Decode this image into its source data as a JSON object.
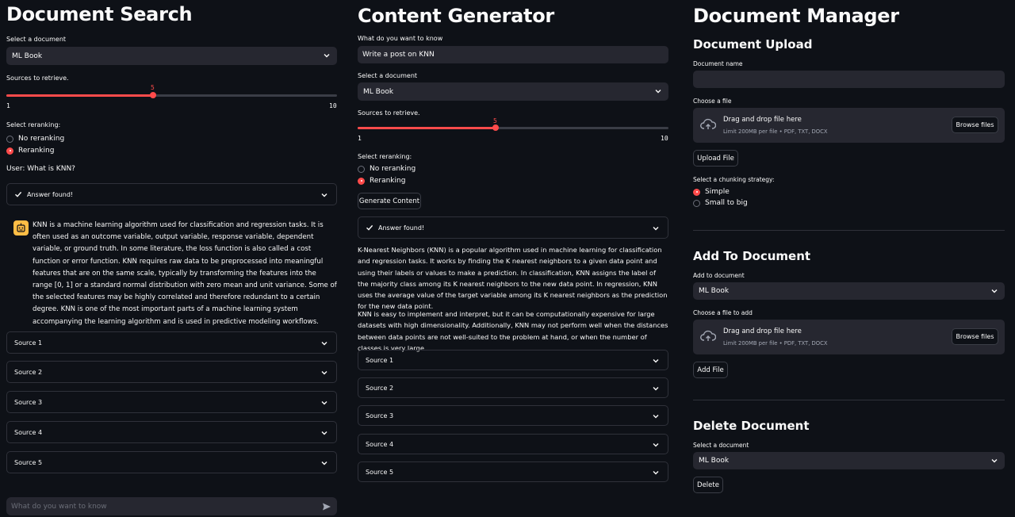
{
  "search": {
    "title": "Document Search",
    "select_doc_label": "Select a document",
    "select_doc_value": "ML Book",
    "sources_label": "Sources to retrieve.",
    "slider": {
      "value": "5",
      "min": "1",
      "max": "10",
      "fraction": 0.444
    },
    "rerank_label": "Select reranking:",
    "rerank_options": [
      "No reranking",
      "Reranking"
    ],
    "user_query": "User: What is KNN?",
    "status": "Answer found!",
    "answer": "KNN is a machine learning algorithm used for classification and regression tasks. It is often used as an outcome variable, output variable, response variable, dependent variable, or ground truth. In some literature, the loss function is also called a cost function or error function. KNN requires raw data to be preprocessed into meaningful features that are on the same scale, typically by transforming the features into the range [0, 1] or a standard normal distribution with zero mean and unit variance. Some of the selected features may be highly correlated and therefore redundant to a certain degree. KNN is one of the most important parts of a machine learning system accompanying the learning algorithm and is used in predictive modeling workflows.",
    "sources": [
      "Source 1",
      "Source 2",
      "Source 3",
      "Source 4",
      "Source 5"
    ],
    "chat_placeholder": "What do you want to know"
  },
  "generator": {
    "title": "Content Generator",
    "prompt_label": "What do you want to know",
    "prompt_value": "Write a post on KNN",
    "select_doc_label": "Select a document",
    "select_doc_value": "ML Book",
    "sources_label": "Sources to retrieve.",
    "slider": {
      "value": "5",
      "min": "1",
      "max": "10",
      "fraction": 0.444
    },
    "rerank_label": "Select reranking:",
    "rerank_options": [
      "No reranking",
      "Reranking"
    ],
    "generate_button": "Generate Content",
    "status": "Answer found!",
    "para1": "K-Nearest Neighbors (KNN) is a popular algorithm used in machine learning for classification and regression tasks. It works by finding the K nearest neighbors to a given data point and using their labels or values to make a prediction. In classification, KNN assigns the label of the majority class among its K nearest neighbors to the new data point. In regression, KNN uses the average value of the target variable among its K nearest neighbors as the prediction for the new data point.",
    "para2": "KNN is easy to implement and interpret, but it can be computationally expensive for large datasets with high dimensionality. Additionally, KNN may not perform well when the distances between data points are not well-suited to the problem at hand, or when the number of classes is very large.",
    "sources": [
      "Source 1",
      "Source 2",
      "Source 3",
      "Source 4",
      "Source 5"
    ]
  },
  "manager": {
    "title": "Document Manager",
    "upload": {
      "heading": "Document Upload",
      "name_label": "Document name",
      "name_value": "",
      "file_label": "Choose a file",
      "drop_text": "Drag and drop file here",
      "limit_text": "Limit 200MB per file • PDF, TXT, DOCX",
      "browse_button": "Browse files",
      "upload_button": "Upload File",
      "chunk_label": "Select a chunking strategy:",
      "chunk_options": [
        "Simple",
        "Small to big"
      ]
    },
    "add": {
      "heading": "Add To Document",
      "doc_label": "Add to document",
      "doc_value": "ML Book",
      "file_label": "Choose a file to add",
      "drop_text": "Drag and drop file here",
      "limit_text": "Limit 200MB per file • PDF, TXT, DOCX",
      "browse_button": "Browse files",
      "add_button": "Add File"
    },
    "delete": {
      "heading": "Delete Document",
      "doc_label": "Select a document",
      "doc_value": "ML Book",
      "delete_button": "Delete"
    }
  },
  "colors": {
    "background": "#0e1117",
    "accent": "#ff4b4b",
    "input_bg": "#262730",
    "avatar": "#ffbd45"
  },
  "icons": [
    "chevron-down-icon",
    "check-icon",
    "robot-icon",
    "cloud-upload-icon",
    "send-icon"
  ]
}
